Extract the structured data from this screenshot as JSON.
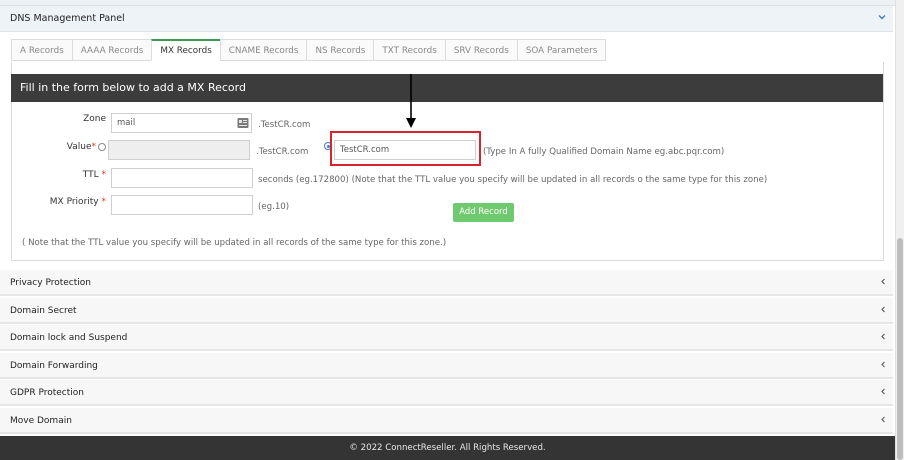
{
  "dns_panel": {
    "title": "DNS Management Panel",
    "collapse_icon": "chevron-down-icon"
  },
  "tabs": [
    {
      "label": "A Records",
      "active": false
    },
    {
      "label": "AAAA Records",
      "active": false
    },
    {
      "label": "MX Records",
      "active": true
    },
    {
      "label": "CNAME Records",
      "active": false
    },
    {
      "label": "NS Records",
      "active": false
    },
    {
      "label": "TXT Records",
      "active": false
    },
    {
      "label": "SRV Records",
      "active": false
    },
    {
      "label": "SOA Parameters",
      "active": false
    }
  ],
  "form": {
    "heading": "Fill in the form below to add a MX Record",
    "zone": {
      "label": "Zone",
      "value": "mail",
      "suffix": ".TestCR.com",
      "icon": "contact-card-icon"
    },
    "value": {
      "label": "Value",
      "required_mark": "*",
      "suffix": ".TestCR.com",
      "fqdn_value": "TestCR.com",
      "fqdn_hint": "(Type In A fully Qualified Domain Name eg.abc.pqr.com)",
      "selected_option": "fqdn"
    },
    "ttl": {
      "label": "TTL",
      "required_mark": "*",
      "value": "",
      "hint": "seconds (eg.172800) (Note that the TTL value you specify will be updated in all records o the same type for this zone)"
    },
    "mx_priority": {
      "label": "MX Priority",
      "required_mark": "*",
      "value": "",
      "hint": "(eg.10)"
    },
    "add_button": "Add Record",
    "note": "( Note that the TTL value you specify will be updated in all records of the same type for this zone.)",
    "annotation_color": "#d9232d"
  },
  "accordion": [
    {
      "label": "Privacy Protection"
    },
    {
      "label": "Domain Secret"
    },
    {
      "label": "Domain lock and Suspend"
    },
    {
      "label": "Domain Forwarding"
    },
    {
      "label": "GDPR Protection"
    },
    {
      "label": "Move Domain"
    }
  ],
  "footer": {
    "text": "© 2022 ConnectReseller. All Rights Reserved."
  },
  "colors": {
    "accent": "#3a9b4f",
    "button": "#6fca6f",
    "header_bar": "#3c3c3c",
    "footer": "#343434"
  }
}
